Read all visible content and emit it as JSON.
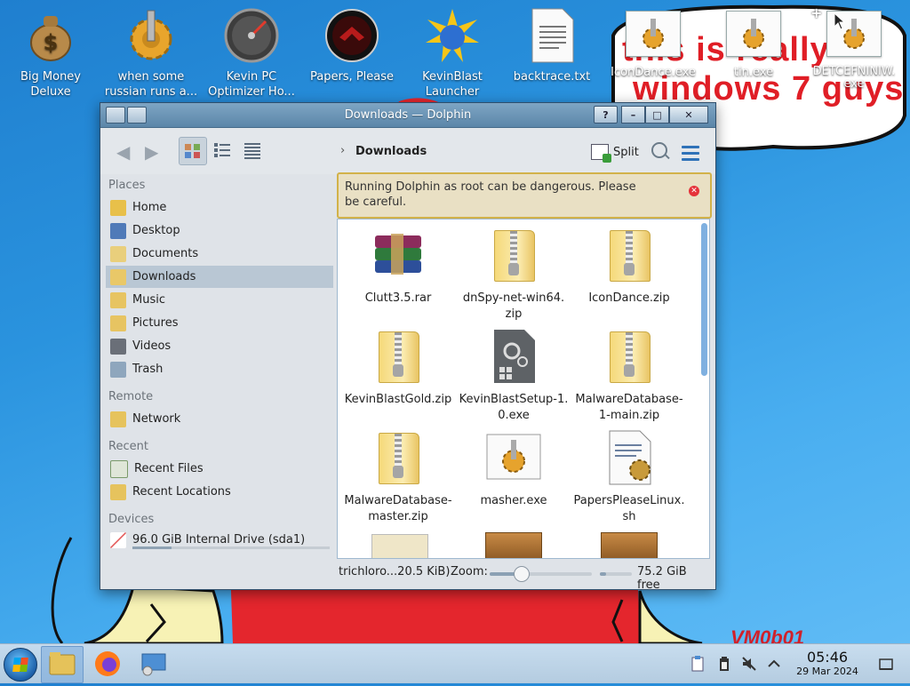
{
  "desktop": {
    "icons": [
      {
        "line1": "Big Money",
        "line2": "Deluxe"
      },
      {
        "line1": "when some",
        "line2": "russian runs a..."
      },
      {
        "line1": "Kevin PC",
        "line2": "Optimizer Ho..."
      },
      {
        "line1": "Papers, Please",
        "line2": ""
      },
      {
        "line1": "KevinBlast",
        "line2": "Launcher"
      },
      {
        "line1": "backtrace.txt",
        "line2": ""
      }
    ],
    "window_icons": [
      {
        "label": "IconDance.exe"
      },
      {
        "label": "tin.exe"
      },
      {
        "label": "DETCEFNINIW.",
        "label2": "exe"
      }
    ],
    "wallpaper_text": {
      "line1": "this is really",
      "line2": "windows 7 guys"
    },
    "watermark": "VM0b01"
  },
  "window": {
    "title": "Downloads — Dolphin",
    "breadcrumb": "Downloads",
    "split_label": "Split",
    "sidebar": {
      "places_header": "Places",
      "places": [
        {
          "label": "Home",
          "icon": "home-icon"
        },
        {
          "label": "Desktop",
          "icon": "desktop-icon"
        },
        {
          "label": "Documents",
          "icon": "documents-icon"
        },
        {
          "label": "Downloads",
          "icon": "downloads-icon",
          "selected": true
        },
        {
          "label": "Music",
          "icon": "music-icon"
        },
        {
          "label": "Pictures",
          "icon": "pictures-icon"
        },
        {
          "label": "Videos",
          "icon": "videos-icon"
        },
        {
          "label": "Trash",
          "icon": "trash-icon"
        }
      ],
      "remote_header": "Remote",
      "remote": [
        {
          "label": "Network",
          "icon": "network-icon"
        }
      ],
      "recent_header": "Recent",
      "recent": [
        {
          "label": "Recent Files",
          "icon": "recent-files-icon"
        },
        {
          "label": "Recent Locations",
          "icon": "recent-locations-icon"
        }
      ],
      "devices_header": "Devices",
      "devices": [
        {
          "label": "96.0 GiB Internal Drive (sda1)",
          "icon": "drive-icon"
        }
      ]
    },
    "warning": "Running Dolphin as root can be dangerous. Please be careful.",
    "files": [
      {
        "l1": "Clutt3.5.rar",
        "l2": "",
        "type": "rar"
      },
      {
        "l1": "dnSpy-net-win64.",
        "l2": "zip",
        "type": "zip"
      },
      {
        "l1": "IconDance.zip",
        "l2": "",
        "type": "zip"
      },
      {
        "l1": "KevinBlastGold.zip",
        "l2": "",
        "type": "zip"
      },
      {
        "l1": "KevinBlastSetup-1.",
        "l2": "0.exe",
        "type": "exe"
      },
      {
        "l1": "MalwareDatabase-",
        "l2": "1-main.zip",
        "type": "zip"
      },
      {
        "l1": "MalwareDatabase-",
        "l2": "master.zip",
        "type": "zip"
      },
      {
        "l1": "masher.exe",
        "l2": "",
        "type": "gear"
      },
      {
        "l1": "PapersPleaseLinux.",
        "l2": "sh",
        "type": "script"
      }
    ],
    "status": {
      "selection": "trichloro...20.5 KiB)",
      "zoom_label": "Zoom:",
      "zoom_level": 0.3,
      "free_space": "75.2 GiB free",
      "used_fraction": 0.2
    }
  },
  "taskbar": {
    "time": "05:46",
    "date": "29 Mar 2024"
  }
}
